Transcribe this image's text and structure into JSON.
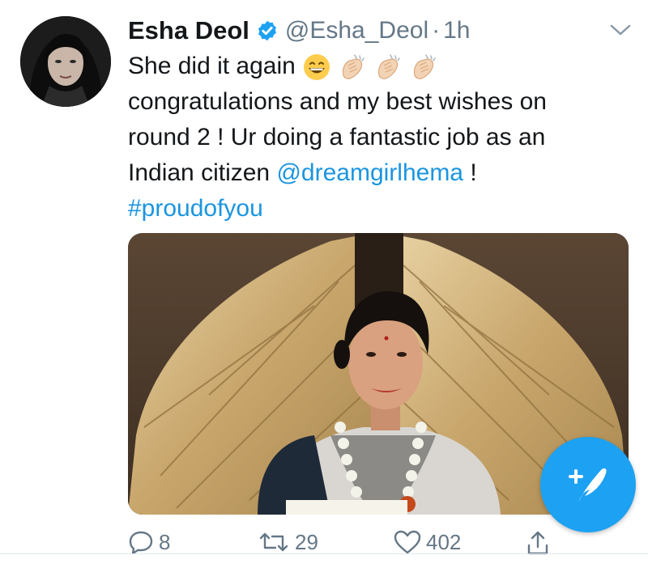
{
  "tweet": {
    "author_name": "Esha Deol",
    "handle": "@Esha_Deol",
    "separator": "·",
    "time": "1h",
    "text": {
      "line1": "She did it again",
      "line2": "congratulations and my best wishes on",
      "line3": "round 2 ! Ur doing a fantastic job as an",
      "line4_prefix": "Indian citizen",
      "mention": "@dreamgirlhema",
      "line4_suffix": "!",
      "hashtag": "#proudofyou"
    },
    "emojis": [
      "grinning-face",
      "clapping-hands",
      "clapping-hands",
      "clapping-hands"
    ],
    "actions": {
      "replies": "8",
      "retweets": "29",
      "likes": "402"
    }
  },
  "colors": {
    "link": "#1b95e0",
    "fab": "#1da1f2",
    "secondary_text": "#657786"
  },
  "icons": {
    "avatar": "avatar",
    "verified": "verified-badge-icon",
    "chevron": "chevron-down-icon",
    "reply": "reply-icon",
    "retweet": "retweet-icon",
    "like": "heart-icon",
    "share": "share-icon",
    "compose": "compose-tweet-icon"
  }
}
